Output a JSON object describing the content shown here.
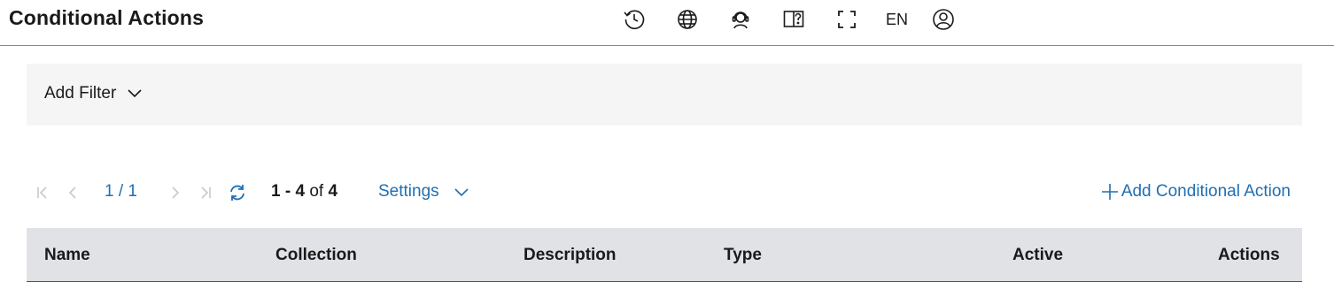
{
  "header": {
    "title": "Conditional Actions",
    "icons": [
      "history-icon",
      "globe-icon",
      "support-icon",
      "help-book-icon",
      "fullscreen-icon",
      "user-icon"
    ],
    "language": "EN"
  },
  "filter": {
    "add_filter_label": "Add Filter"
  },
  "toolbar": {
    "page_indicator": "1 / 1",
    "range_start": "1",
    "range_sep": " - ",
    "range_end": "4",
    "range_of": " of ",
    "range_total": "4",
    "settings_label": "Settings",
    "add_action_label": "Add Conditional Action"
  },
  "table": {
    "columns": [
      "Name",
      "Collection",
      "Description",
      "Type",
      "Active",
      "Actions"
    ]
  },
  "colors": {
    "accent": "#1f6fb2",
    "header_bg": "#e0e2e5",
    "filter_bg": "#f5f5f5"
  }
}
